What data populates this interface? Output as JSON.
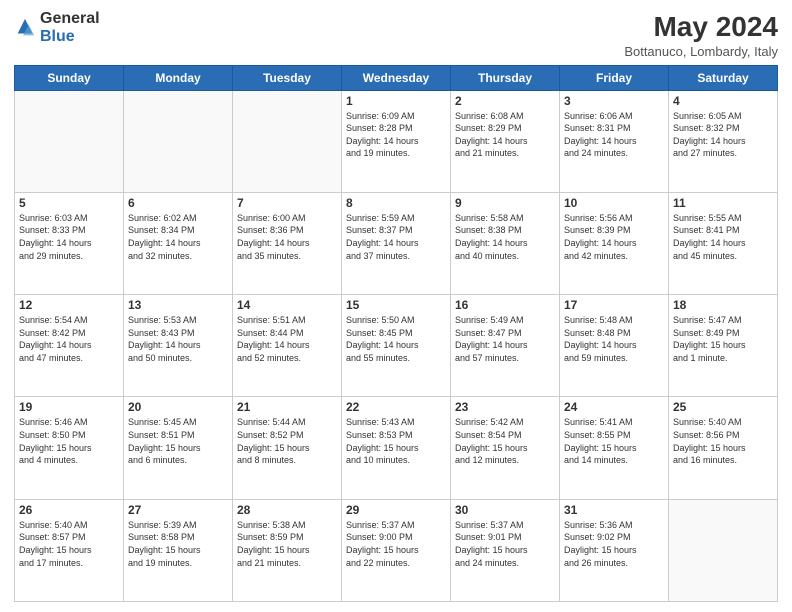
{
  "logo": {
    "general": "General",
    "blue": "Blue"
  },
  "header": {
    "month": "May 2024",
    "location": "Bottanuco, Lombardy, Italy"
  },
  "days_of_week": [
    "Sunday",
    "Monday",
    "Tuesday",
    "Wednesday",
    "Thursday",
    "Friday",
    "Saturday"
  ],
  "weeks": [
    [
      {
        "day": "",
        "detail": ""
      },
      {
        "day": "",
        "detail": ""
      },
      {
        "day": "",
        "detail": ""
      },
      {
        "day": "1",
        "detail": "Sunrise: 6:09 AM\nSunset: 8:28 PM\nDaylight: 14 hours\nand 19 minutes."
      },
      {
        "day": "2",
        "detail": "Sunrise: 6:08 AM\nSunset: 8:29 PM\nDaylight: 14 hours\nand 21 minutes."
      },
      {
        "day": "3",
        "detail": "Sunrise: 6:06 AM\nSunset: 8:31 PM\nDaylight: 14 hours\nand 24 minutes."
      },
      {
        "day": "4",
        "detail": "Sunrise: 6:05 AM\nSunset: 8:32 PM\nDaylight: 14 hours\nand 27 minutes."
      }
    ],
    [
      {
        "day": "5",
        "detail": "Sunrise: 6:03 AM\nSunset: 8:33 PM\nDaylight: 14 hours\nand 29 minutes."
      },
      {
        "day": "6",
        "detail": "Sunrise: 6:02 AM\nSunset: 8:34 PM\nDaylight: 14 hours\nand 32 minutes."
      },
      {
        "day": "7",
        "detail": "Sunrise: 6:00 AM\nSunset: 8:36 PM\nDaylight: 14 hours\nand 35 minutes."
      },
      {
        "day": "8",
        "detail": "Sunrise: 5:59 AM\nSunset: 8:37 PM\nDaylight: 14 hours\nand 37 minutes."
      },
      {
        "day": "9",
        "detail": "Sunrise: 5:58 AM\nSunset: 8:38 PM\nDaylight: 14 hours\nand 40 minutes."
      },
      {
        "day": "10",
        "detail": "Sunrise: 5:56 AM\nSunset: 8:39 PM\nDaylight: 14 hours\nand 42 minutes."
      },
      {
        "day": "11",
        "detail": "Sunrise: 5:55 AM\nSunset: 8:41 PM\nDaylight: 14 hours\nand 45 minutes."
      }
    ],
    [
      {
        "day": "12",
        "detail": "Sunrise: 5:54 AM\nSunset: 8:42 PM\nDaylight: 14 hours\nand 47 minutes."
      },
      {
        "day": "13",
        "detail": "Sunrise: 5:53 AM\nSunset: 8:43 PM\nDaylight: 14 hours\nand 50 minutes."
      },
      {
        "day": "14",
        "detail": "Sunrise: 5:51 AM\nSunset: 8:44 PM\nDaylight: 14 hours\nand 52 minutes."
      },
      {
        "day": "15",
        "detail": "Sunrise: 5:50 AM\nSunset: 8:45 PM\nDaylight: 14 hours\nand 55 minutes."
      },
      {
        "day": "16",
        "detail": "Sunrise: 5:49 AM\nSunset: 8:47 PM\nDaylight: 14 hours\nand 57 minutes."
      },
      {
        "day": "17",
        "detail": "Sunrise: 5:48 AM\nSunset: 8:48 PM\nDaylight: 14 hours\nand 59 minutes."
      },
      {
        "day": "18",
        "detail": "Sunrise: 5:47 AM\nSunset: 8:49 PM\nDaylight: 15 hours\nand 1 minute."
      }
    ],
    [
      {
        "day": "19",
        "detail": "Sunrise: 5:46 AM\nSunset: 8:50 PM\nDaylight: 15 hours\nand 4 minutes."
      },
      {
        "day": "20",
        "detail": "Sunrise: 5:45 AM\nSunset: 8:51 PM\nDaylight: 15 hours\nand 6 minutes."
      },
      {
        "day": "21",
        "detail": "Sunrise: 5:44 AM\nSunset: 8:52 PM\nDaylight: 15 hours\nand 8 minutes."
      },
      {
        "day": "22",
        "detail": "Sunrise: 5:43 AM\nSunset: 8:53 PM\nDaylight: 15 hours\nand 10 minutes."
      },
      {
        "day": "23",
        "detail": "Sunrise: 5:42 AM\nSunset: 8:54 PM\nDaylight: 15 hours\nand 12 minutes."
      },
      {
        "day": "24",
        "detail": "Sunrise: 5:41 AM\nSunset: 8:55 PM\nDaylight: 15 hours\nand 14 minutes."
      },
      {
        "day": "25",
        "detail": "Sunrise: 5:40 AM\nSunset: 8:56 PM\nDaylight: 15 hours\nand 16 minutes."
      }
    ],
    [
      {
        "day": "26",
        "detail": "Sunrise: 5:40 AM\nSunset: 8:57 PM\nDaylight: 15 hours\nand 17 minutes."
      },
      {
        "day": "27",
        "detail": "Sunrise: 5:39 AM\nSunset: 8:58 PM\nDaylight: 15 hours\nand 19 minutes."
      },
      {
        "day": "28",
        "detail": "Sunrise: 5:38 AM\nSunset: 8:59 PM\nDaylight: 15 hours\nand 21 minutes."
      },
      {
        "day": "29",
        "detail": "Sunrise: 5:37 AM\nSunset: 9:00 PM\nDaylight: 15 hours\nand 22 minutes."
      },
      {
        "day": "30",
        "detail": "Sunrise: 5:37 AM\nSunset: 9:01 PM\nDaylight: 15 hours\nand 24 minutes."
      },
      {
        "day": "31",
        "detail": "Sunrise: 5:36 AM\nSunset: 9:02 PM\nDaylight: 15 hours\nand 26 minutes."
      },
      {
        "day": "",
        "detail": ""
      }
    ]
  ]
}
